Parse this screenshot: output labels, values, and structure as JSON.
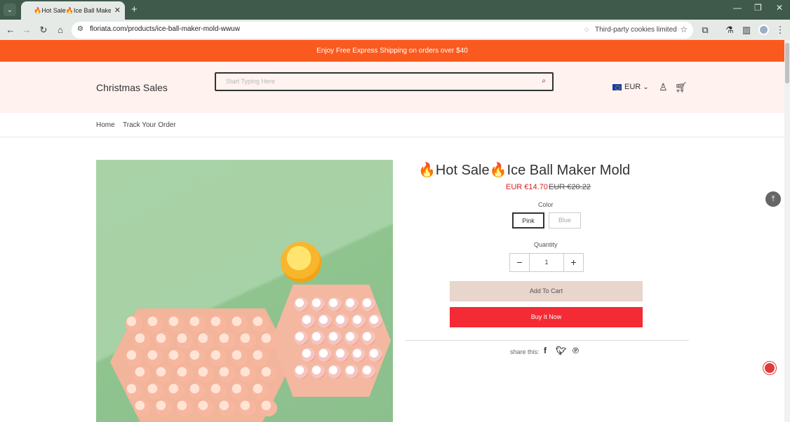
{
  "browser": {
    "tab_title": "🔥Hot Sale🔥Ice Ball Maker M",
    "url": "floriata.com/products/ice-ball-maker-mold-wwuw",
    "cookie_chip": "Third-party cookies limited"
  },
  "store": {
    "announcement": "Enjoy Free Express Shipping on orders over $40",
    "logo": "Christmas Sales",
    "search_placeholder": "Start Typing Here",
    "currency": "EUR",
    "nav": [
      "Home",
      "Track Your Order"
    ]
  },
  "product": {
    "title": "🔥Hot Sale🔥Ice Ball Maker Mold",
    "price": "EUR €14.70",
    "compare_price": "EUR €20.22",
    "color_label": "Color",
    "colors": [
      "Pink",
      "Blue"
    ],
    "selected_color": "Pink",
    "quantity_label": "Quantity",
    "quantity": "1",
    "add_to_cart": "Add To Cart",
    "buy_now": "Buy It Now",
    "share_label": "share this:"
  },
  "icons": {
    "back": "arrow-left-icon",
    "forward": "arrow-right-icon",
    "reload": "reload-icon",
    "home": "home-icon",
    "search": "search-icon",
    "user": "user-icon",
    "cart": "cart-icon",
    "facebook": "facebook-icon",
    "twitter": "twitter-icon",
    "pinterest": "pinterest-icon"
  },
  "colors": {
    "browser_frame": "#3f5a4b",
    "announcement_bg": "#fb5a1f",
    "header_bg": "#fff2ef",
    "price": "#d9211f",
    "buy_button": "#f42a35",
    "cart_button": "#e8d5cc"
  }
}
